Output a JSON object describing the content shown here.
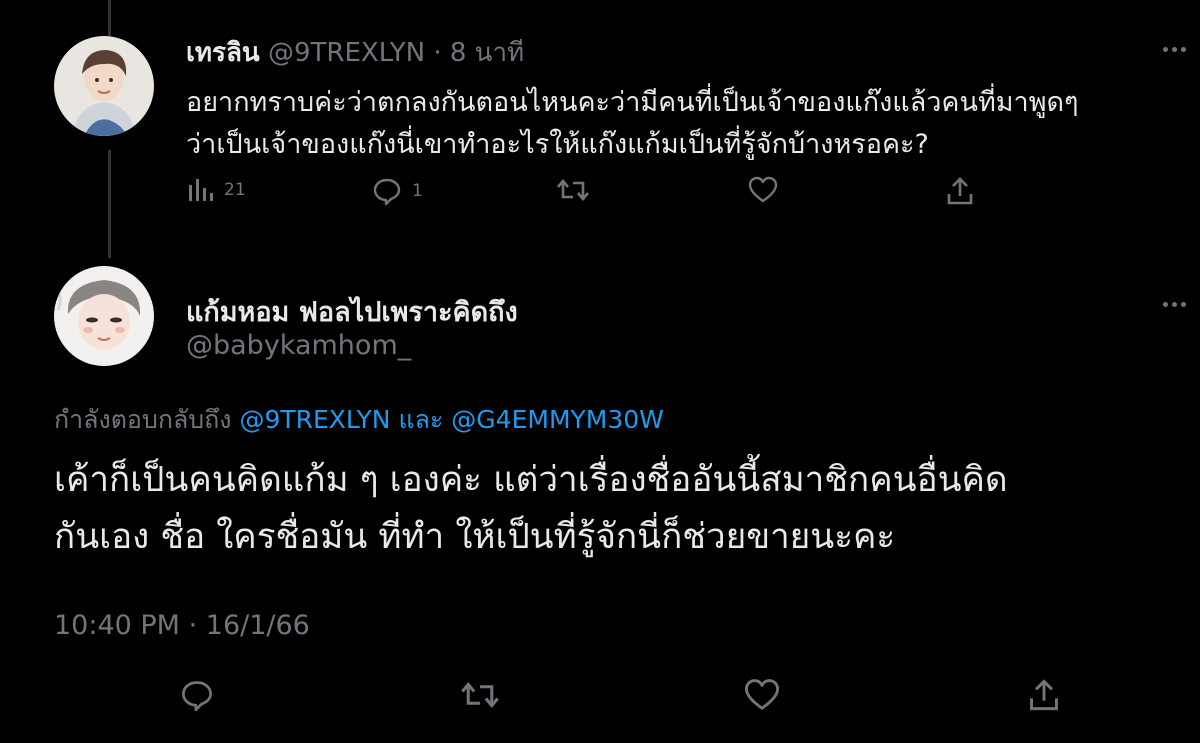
{
  "parent_tweet": {
    "display_name": "เทรลิน",
    "handle": "@9TREXLYN",
    "separator": "·",
    "time": "8 นาที",
    "text_line1": "อยากทราบค่ะว่าตกลงกันตอนไหนคะว่ามีคนที่เป็นเจ้าของแก๊งแล้วคนที่มาพูดๆ",
    "text_line2": "ว่าเป็นเจ้าของแก๊งนี่เขาทำอะไรให้แก๊งแก้มเป็นที่รู้จักบ้างหรอคะ?",
    "views_count": "21",
    "reply_count": "1"
  },
  "main_tweet": {
    "display_name": "แก้มหอม ฟอลไปเพราะคิดถึง",
    "handle": "@babykamhom_",
    "replying_prefix": "กำลังตอบกลับถึง",
    "reply_mention_1": "@9TREXLYN",
    "reply_conj": "และ",
    "reply_mention_2": "@G4EMMYM30W",
    "text_line1": "เค้าก็เป็นคนคิดแก้ม ๆ เองค่ะ แต่ว่าเรื่องชื่ออันนี้สมาชิกคนอื่นคิด",
    "text_line2": "กันเอง ชื่อ ใครชื่อมัน ที่ทำ ให้เป็นที่รู้จักนี่ก็ช่วยขายนะคะ",
    "time": "10:40 PM",
    "date_separator": "·",
    "date": "16/1/66"
  },
  "icons": {
    "views": "bar-chart-icon",
    "reply": "speech-bubble-icon",
    "retweet": "retweet-icon",
    "like": "heart-icon",
    "share": "share-upload-icon",
    "more": "more-dots-icon"
  },
  "colors": {
    "background": "#000000",
    "text": "#e7e9ea",
    "muted": "#71767b",
    "link": "#1d9bf0"
  }
}
